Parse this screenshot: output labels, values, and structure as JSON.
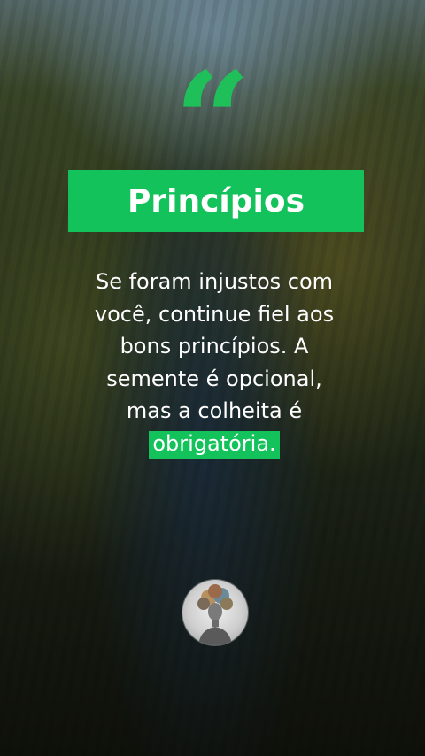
{
  "title": "Princípios",
  "quote_mark": "“",
  "quote": {
    "lines": [
      "Se foram injustos com",
      "você, continue fiel aos",
      "bons princípios. A",
      "semente é opcional,",
      "mas a colheita é"
    ],
    "highlight": "obrigatória."
  },
  "colors": {
    "accent": "#13c25a",
    "text": "#ffffff"
  },
  "icons": {
    "quote": "quote-mark-icon",
    "avatar": "author-avatar"
  }
}
